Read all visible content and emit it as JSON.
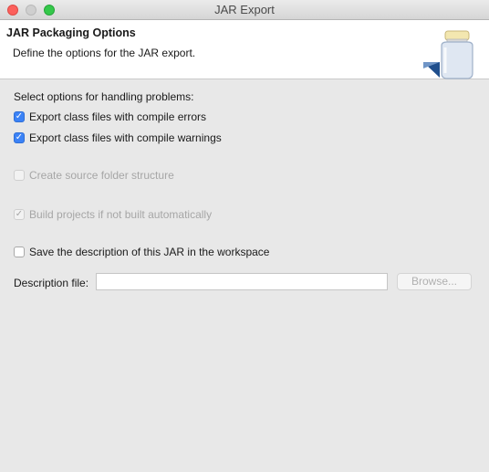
{
  "window": {
    "title": "JAR Export"
  },
  "banner": {
    "title": "JAR Packaging Options",
    "description": "Define the options for the JAR export."
  },
  "problems": {
    "label": "Select options for handling problems:",
    "options": [
      {
        "label": "Export class files with compile errors",
        "checked": true,
        "enabled": true
      },
      {
        "label": "Export class files with compile warnings",
        "checked": true,
        "enabled": true
      }
    ]
  },
  "source_folder": {
    "label": "Create source folder structure",
    "checked": false,
    "enabled": false
  },
  "build_projects": {
    "label": "Build projects if not built automatically",
    "checked": true,
    "enabled": false
  },
  "save_description": {
    "label": "Save the description of this JAR in the workspace",
    "checked": false,
    "enabled": true
  },
  "description_file": {
    "label": "Description file:",
    "value": "",
    "browse_label": "Browse..."
  },
  "colors": {
    "accent": "#3b82f6",
    "close": "#fc605c",
    "maximize": "#34c84a"
  }
}
